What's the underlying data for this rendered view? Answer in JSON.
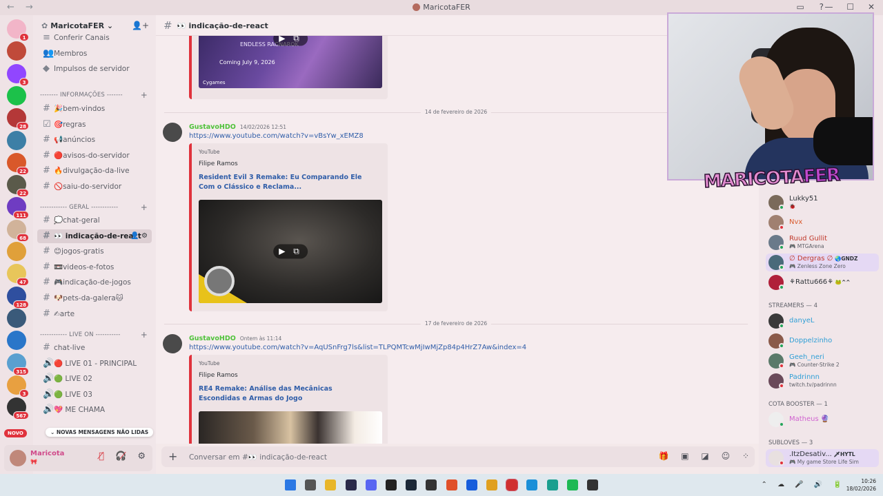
{
  "window": {
    "title": "MaricotaFER",
    "nav": "← →",
    "icons": [
      "inbox-icon",
      "help-icon"
    ],
    "controls": [
      "—",
      "☐",
      "✕"
    ]
  },
  "rail": {
    "servers": [
      {
        "name": "dm-home",
        "color": "#f2b5c8",
        "badge": "1"
      },
      {
        "name": "server-a",
        "color": "#c04a3a",
        "badge": ""
      },
      {
        "name": "server-twitch",
        "color": "#9146ff",
        "badge": "3"
      },
      {
        "name": "server-k",
        "color": "#1cc14a",
        "badge": ""
      },
      {
        "name": "server-b",
        "color": "#b43838",
        "badge": "28"
      },
      {
        "name": "server-c",
        "color": "#3d7fa6",
        "badge": ""
      },
      {
        "name": "server-d",
        "color": "#d9582a",
        "badge": "22"
      },
      {
        "name": "server-e",
        "color": "#5a5a4a",
        "badge": "22"
      },
      {
        "name": "server-f",
        "color": "#6f3cc2",
        "badge": "111"
      },
      {
        "name": "server-g",
        "color": "#d1b39a",
        "badge": "68"
      },
      {
        "name": "server-h",
        "color": "#e0a03a",
        "badge": ""
      },
      {
        "name": "server-i",
        "color": "#e8c65a",
        "badge": "47"
      },
      {
        "name": "server-j",
        "color": "#2f4f9f",
        "badge": "128"
      },
      {
        "name": "server-k2",
        "color": "#3a5a7a",
        "badge": ""
      },
      {
        "name": "server-l",
        "color": "#2a76c9",
        "badge": ""
      },
      {
        "name": "server-m",
        "color": "#5aa0d0",
        "badge": "315"
      },
      {
        "name": "server-n",
        "color": "#e8a040",
        "badge": "3"
      },
      {
        "name": "server-o",
        "color": "#333333",
        "badge": "567"
      }
    ],
    "new_label": "NOVO"
  },
  "sidebar": {
    "server_name": "MaricotaFER",
    "items_top": [
      {
        "icon": "≡",
        "label": "Conferir Canais"
      },
      {
        "icon": "👥",
        "label": "Membros"
      },
      {
        "icon": "◆",
        "label": "Impulsos de servidor"
      }
    ],
    "categories": [
      {
        "label": "-------- INFORMAÇÕES -------"
      },
      {
        "label": "------------ GERAL ------------"
      },
      {
        "label": "------------ LIVE ON -----------"
      }
    ],
    "channels_info": [
      {
        "icon": "#",
        "label": "🎉bem-vindos"
      },
      {
        "icon": "☑",
        "label": "🎯regras"
      },
      {
        "icon": "#",
        "label": "📢anúncios"
      },
      {
        "icon": "#",
        "label": "🔴avisos-do-servidor"
      },
      {
        "icon": "#",
        "label": "🔥divulgação-da-live"
      },
      {
        "icon": "#",
        "label": "🚫saiu-do-servidor"
      }
    ],
    "channels_geral": [
      {
        "icon": "#",
        "label": "💭chat-geral"
      },
      {
        "icon": "#",
        "label": "👀 indicação-de-react",
        "active": true
      },
      {
        "icon": "#",
        "label": "😊jogos-gratis"
      },
      {
        "icon": "#",
        "label": "📼videos-e-fotos"
      },
      {
        "icon": "#",
        "label": "🎮indicação-de-jogos"
      },
      {
        "icon": "#",
        "label": "🐶pets-da-galera🐱"
      },
      {
        "icon": "#",
        "label": "✍arte"
      }
    ],
    "channels_live": [
      {
        "icon": "#",
        "label": "chat-live"
      },
      {
        "icon": "🔊",
        "label": "🔴 LIVE 01 - PRINCIPAL"
      },
      {
        "icon": "🔊",
        "label": "🟢 LIVE 02"
      },
      {
        "icon": "🔊",
        "label": "🟢 LIVE 03"
      },
      {
        "icon": "🔊",
        "label": "💖 ME CHAMA"
      }
    ],
    "new_messages": "NOVAS MENSAGENS NÃO LIDAS",
    "user": {
      "name": "Maricota",
      "status": "🎀"
    }
  },
  "chat": {
    "channel": "👀 indicação-de-react",
    "placeholder": "Conversar em #👀 indicação-de-react",
    "dividers": [
      "14 de fevereiro de 2026",
      "17 de fevereiro de 2026"
    ],
    "messages": [
      {
        "user": "GustavoHDO",
        "time": "14/02/2026 12:51",
        "link": "https://www.youtube.com/watch?v=vBsYw_xEMZ8",
        "provider": "YouTube",
        "author": "Filipe Ramos",
        "title": "Resident Evil 3 Remake: Eu Comparando Ele Com o Clássico e Reclama..."
      },
      {
        "user": "GustavoHDO",
        "time": "Ontem às 11:14",
        "link": "https://www.youtube.com/watch?v=AqUSnFrg7ls&list=TLPQMTcwMjIwMjZp84p4HrZ7Aw&index=4",
        "provider": "YouTube",
        "author": "Filipe Ramos",
        "title": "RE4 Remake: Análise das Mecânicas Escondidas e Armas do Jogo"
      }
    ],
    "prev_embed": {
      "line1": "ENDLESS RAGNAROK",
      "line2": "Coming July 9, 2026",
      "brand": "Cygames"
    }
  },
  "members": {
    "online": [
      {
        "name": "Lukky51",
        "activity": "🐞",
        "color": "#2e3338",
        "ava": "#7a6a5a",
        "status": "#23a55a"
      },
      {
        "name": "Nvx",
        "activity": "",
        "color": "#d9582a",
        "ava": "#a08070",
        "status": "#e0323c"
      },
      {
        "name": "Ruud Gullit",
        "activity": "🎮 MTGArena",
        "color": "#c0392b",
        "ava": "#6a7a8a",
        "status": "#23a55a"
      },
      {
        "name": "∅ Dergras ∅",
        "tag": "🌏GNDZ",
        "activity": "🎮 Zenless Zone Zero",
        "color": "#c0392b",
        "ava": "#4a6a7a",
        "status": "#23a55a",
        "highlight": true
      },
      {
        "name": "⚘Rattu666⚘",
        "tag": "🐸^^",
        "activity": "",
        "color": "#2e3338",
        "ava": "#b0203a",
        "status": "#23a55a"
      }
    ],
    "streamers_label": "STREAMERS — 4",
    "streamers": [
      {
        "name": "danyeL",
        "activity": "",
        "color": "#2f9fd6",
        "ava": "#3a3a3a",
        "status": "#23a55a"
      },
      {
        "name": "Doppelzinho",
        "activity": "",
        "color": "#2f9fd6",
        "ava": "#8a5a4a",
        "status": "#23a55a"
      },
      {
        "name": "Geeh_neri",
        "activity": "🎮 Counter-Strike 2",
        "color": "#2f9fd6",
        "ava": "#5a7a6a",
        "status": "#e0323c"
      },
      {
        "name": "Padrinnn",
        "activity": "twitch.tv/padrinnn",
        "color": "#2f9fd6",
        "ava": "#6a4a5a",
        "status": "#e0323c"
      }
    ],
    "booster_label": "COTA BOOSTER — 1",
    "boosters": [
      {
        "name": "Matheus 🔮",
        "activity": "",
        "color": "#d063d0",
        "ava": "#eeeeee",
        "status": "#23a55a"
      }
    ],
    "sublove_label": "SUBLOVES — 3",
    "sublove": [
      {
        "name": ".ItzDesativ...",
        "tag": "🗡HYTL",
        "activity": "🎮 My game Store Life Sim",
        "color": "#2e3338",
        "ava": "#e8e0e0",
        "status": "#e0323c",
        "highlight": true
      }
    ]
  },
  "overlay": {
    "logo_a": "MARICOTA",
    "logo_b": "FER"
  },
  "taskbar": {
    "apps": [
      "windows-icon",
      "task-view-icon",
      "explorer-icon",
      "terminal-icon",
      "discord-icon",
      "epic-icon",
      "steam-icon",
      "obs-icon",
      "brave-icon",
      "bitwarden-icon",
      "chrome-icon",
      "opera-icon",
      "edge-icon",
      "edge-dev-icon",
      "spotify-icon",
      "app-icon"
    ],
    "tray": "⌃ ☁ 🎤 🔊 🔋",
    "time": "10:26",
    "date": "18/02/2026"
  }
}
